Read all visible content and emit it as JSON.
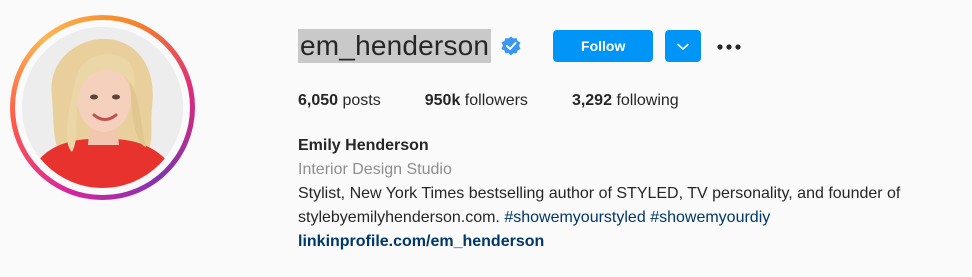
{
  "profile": {
    "username": "em_henderson",
    "verified_icon": "verified-badge-icon",
    "follow_label": "Follow",
    "suggest_icon": "chevron-down-icon",
    "more_icon": "more-options-icon",
    "stats": {
      "posts_count": "6,050",
      "posts_label": "posts",
      "followers_count": "950k",
      "followers_label": "followers",
      "following_count": "3,292",
      "following_label": "following"
    },
    "bio": {
      "full_name": "Emily Henderson",
      "category": "Interior Design Studio",
      "text_line1": "Stylist, New York Times bestselling author of STYLED, TV personality, and founder of",
      "text_line2": "stylebyemilyhenderson.com.",
      "hashtag1": "#showemyourstyled",
      "hashtag2": "#showemyourdiy",
      "link": "linkinprofile.com/em_henderson"
    }
  },
  "colors": {
    "accent": "#0095f6",
    "link": "#00376b",
    "secondary_text": "#8e8e8e",
    "verified": "#3897f0"
  }
}
